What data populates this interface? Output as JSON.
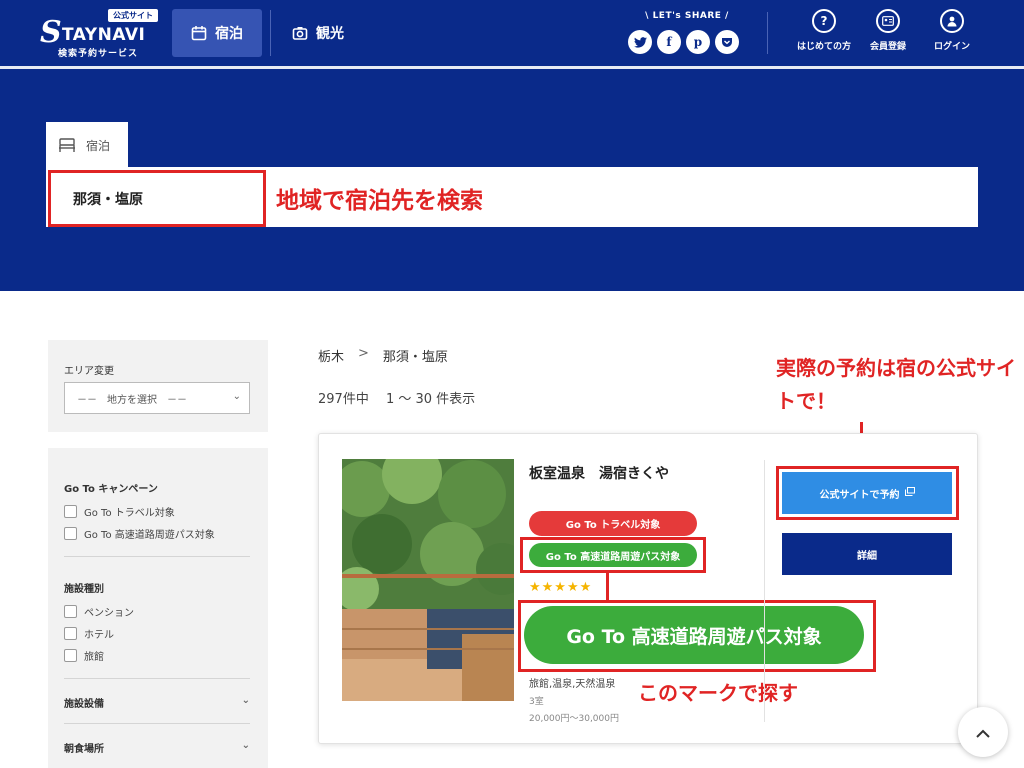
{
  "header": {
    "logo": {
      "badge": "公式サイト",
      "mark": "S",
      "word": "TAYNAVI",
      "sub": "検索予約サービス"
    },
    "nav": [
      {
        "label": "宿泊",
        "icon": "calendar-icon",
        "active": true
      },
      {
        "label": "観光",
        "icon": "camera-icon",
        "active": false
      }
    ],
    "share": {
      "label": "\\ LET's SHARE /",
      "icons": [
        "twitter-icon",
        "facebook-icon",
        "pinterest-icon",
        "pocket-icon"
      ]
    },
    "links": [
      {
        "label": "はじめての方",
        "icon": "help-icon"
      },
      {
        "label": "会員登録",
        "icon": "member-card-icon"
      },
      {
        "label": "ログイン",
        "icon": "user-icon"
      }
    ]
  },
  "search": {
    "tab_label": "宿泊",
    "area_value": "那須・塩原",
    "annotation": "地域で宿泊先を検索"
  },
  "sidebar": {
    "area_label": "エリア変更",
    "area_select": "－－　地方を選択　－－",
    "groups": [
      {
        "title": "Go To キャンペーン",
        "items": [
          "Go To トラベル対象",
          "Go To 高速道路周遊パス対象"
        ]
      },
      {
        "title": "施設種別",
        "items": [
          "ペンション",
          "ホテル",
          "旅館"
        ]
      }
    ],
    "collapsed": [
      "施設設備",
      "朝食場所"
    ]
  },
  "main": {
    "breadcrumb": [
      "栃木",
      ">",
      "那須・塩原"
    ],
    "count_text": "297件中　 1 ～ 30 件表示",
    "annotation_booking": "実際の予約は宿の公式サイトで！",
    "annotation_mark": "このマークで探す",
    "card": {
      "name": "板室温泉　湯宿きくや",
      "badge_travel": "Go To トラベル対象",
      "badge_road": "Go To 高速道路周遊パス対象",
      "stars": "★★★★★",
      "star_rating": 5,
      "big_badge": "Go To 高速道路周遊パス対象",
      "tags": "旅館,温泉,天然温泉",
      "grade": "3室",
      "price": "20,000円～30,000円",
      "book_label": "公式サイトで予約",
      "detail_label": "詳細"
    }
  },
  "colors": {
    "brand_navy": "#0a2a8a",
    "annotation_red": "#e02424",
    "go_to_green": "#3cac3c",
    "travel_red": "#e53a3a",
    "book_blue": "#2f8de4"
  }
}
